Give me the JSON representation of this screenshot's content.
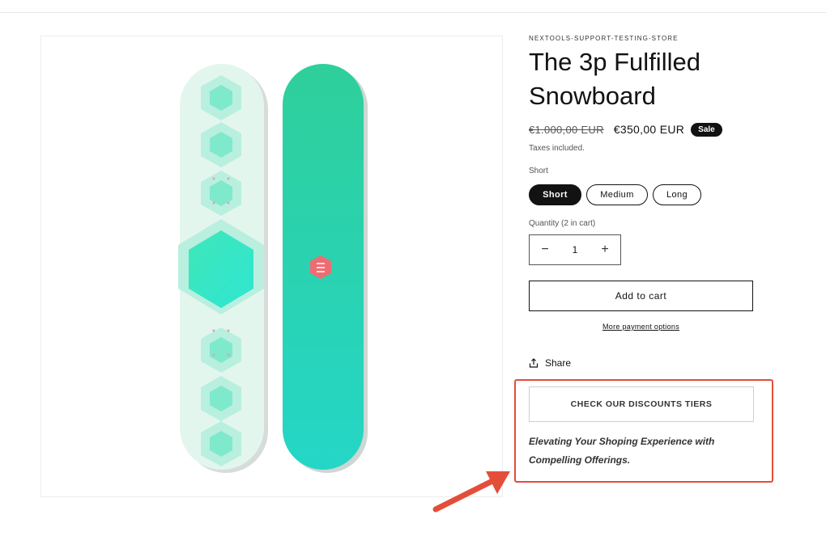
{
  "product": {
    "vendor": "NEXTOOLS-SUPPORT-TESTING-STORE",
    "title": "The 3p Fulfilled Snowboard",
    "price_compare": "€1.000,00 EUR",
    "price_sale": "€350,00 EUR",
    "badge": "Sale",
    "tax_note": "Taxes included."
  },
  "variant": {
    "label": "Short",
    "options": [
      "Short",
      "Medium",
      "Long"
    ],
    "selected": "Short"
  },
  "quantity": {
    "label": "Quantity (2 in cart)",
    "value": "1",
    "minus": "−",
    "plus": "+"
  },
  "actions": {
    "add_to_cart": "Add to cart",
    "more_payment": "More payment options",
    "share": "Share"
  },
  "promo": {
    "button": "CHECK OUR DISCOUNTS TIERS",
    "tagline": "Elevating Your Shoping Experience with Compelling Offerings."
  },
  "colors": {
    "accent": "#121212",
    "highlight": "#e44d3a",
    "board_mint": "#dff5ec",
    "board_teal": "#2fd4a4"
  },
  "icons": [
    "share-icon",
    "arrow-icon"
  ]
}
